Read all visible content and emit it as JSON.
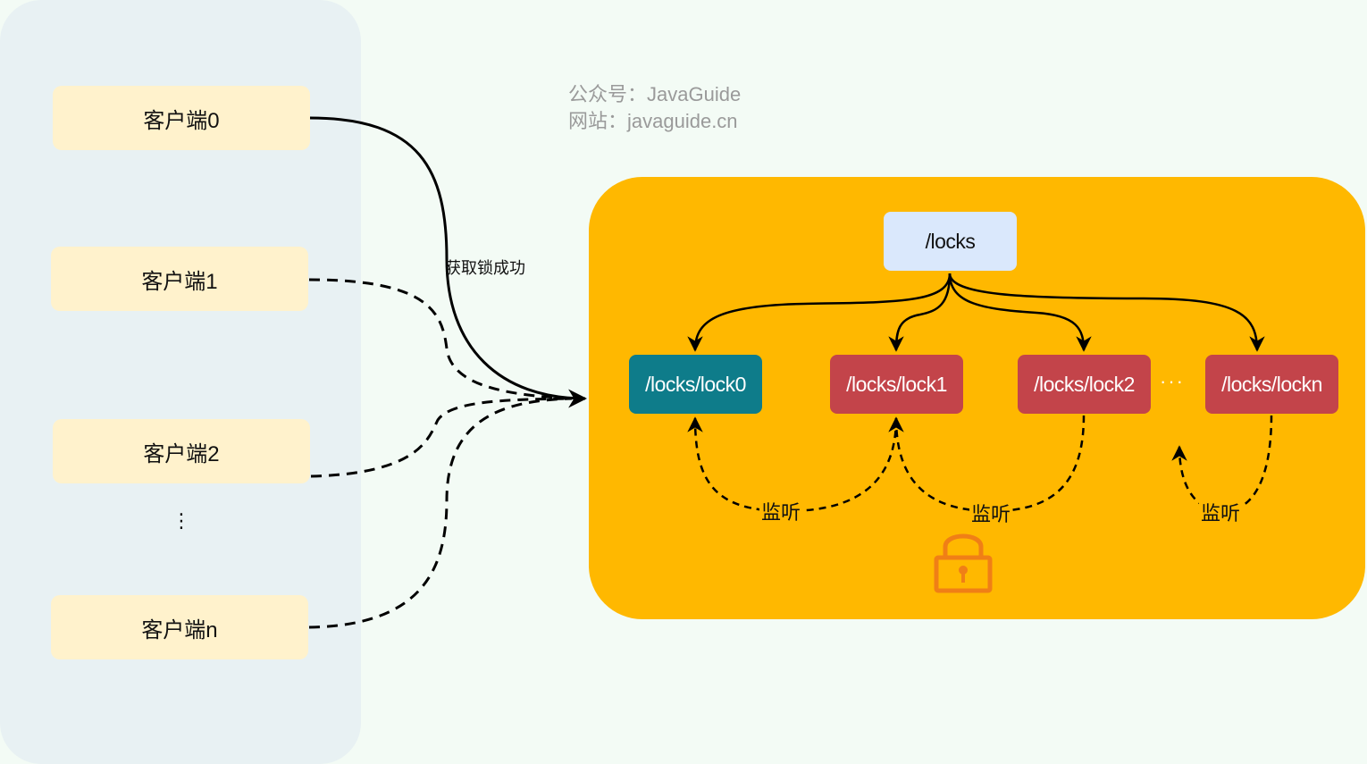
{
  "watermark": {
    "line1": "公众号：JavaGuide",
    "line2": "网站：javaguide.cn"
  },
  "clients": {
    "client0": "客户端0",
    "client1": "客户端1",
    "client2": "客户端2",
    "ellipsis": "⋮",
    "clientn": "客户端n"
  },
  "edges": {
    "acquire_success": "获取锁成功"
  },
  "zookeeper": {
    "root": "/locks",
    "lock0": "/locks/lock0",
    "lock1": "/locks/lock1",
    "lock2": "/locks/lock2",
    "ellipsis": "···",
    "lockn": "/locks/lockn",
    "listen_label": "监听"
  },
  "colors": {
    "client_panel": "#e8f1f3",
    "client_box": "#fff2cc",
    "zk_panel": "#ffb800",
    "root_node": "#dae8fc",
    "held_node": "#0e7c8a",
    "waiting_node": "#c3444a",
    "lock_icon": "#f07f16"
  },
  "icons": {
    "lock": "padlock-icon"
  }
}
